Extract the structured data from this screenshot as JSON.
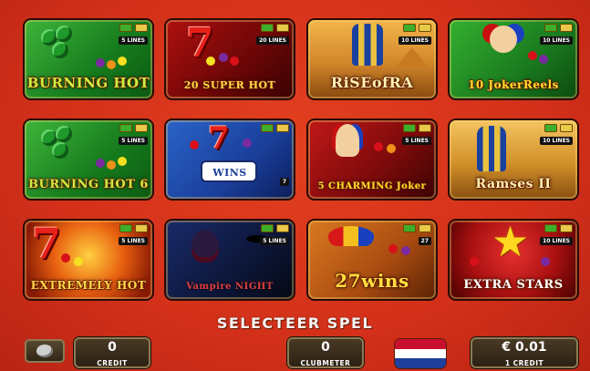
{
  "games": [
    {
      "id": "burning-hot",
      "title": "BURNING HOT",
      "lines": "5 LINES"
    },
    {
      "id": "20-super-hot",
      "title": "20 SUPER HOT",
      "lines": "20 LINES"
    },
    {
      "id": "rise-of-ra",
      "title": "RiSEofRA",
      "lines": "10 LINES"
    },
    {
      "id": "10-joker-reels",
      "title": "10 JokerReels",
      "lines": "10 LINES"
    },
    {
      "id": "burning-hot-6",
      "title": "BURNING HOT 6",
      "lines": "5 LINES"
    },
    {
      "id": "7-wins",
      "title": "WINS",
      "lines": "7"
    },
    {
      "id": "5-charming-joker",
      "title": "5 CHARMING Joker",
      "lines": "5 LINES"
    },
    {
      "id": "ramses-ii",
      "title": "Ramses II",
      "lines": "10 LINES"
    },
    {
      "id": "extremely-hot",
      "title": "EXTREMELY HOT",
      "lines": "5 LINES"
    },
    {
      "id": "vampire-night",
      "title": "Vampire NIGHT",
      "lines": "5 LINES"
    },
    {
      "id": "27-wins",
      "title": "27wins",
      "lines": "27"
    },
    {
      "id": "extra-stars",
      "title": "EXTRA STARS",
      "lines": "10 LINES"
    }
  ],
  "select_label": "SELECTEER SPEL",
  "credit": {
    "value": "0",
    "caption": "CREDIT"
  },
  "clubmeter": {
    "value": "0",
    "caption": "CLUBMETER"
  },
  "denomination": {
    "value": "€ 0.01",
    "caption": "1 CREDIT"
  },
  "colors": {
    "background": "#d8321a",
    "panel": "#3a2c1a",
    "title_gold": "#ffd84a"
  },
  "icons": [
    "speaker-icon",
    "netherlands-flag-icon"
  ]
}
